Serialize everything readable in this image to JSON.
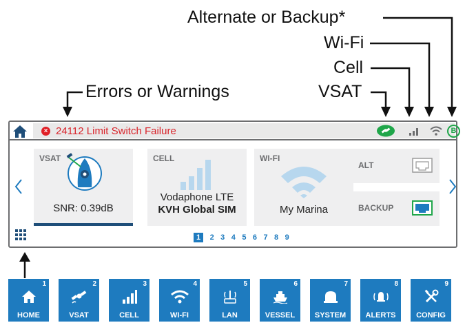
{
  "callouts": {
    "alternate": "Alternate or Backup*",
    "wifi": "Wi-Fi",
    "cell": "Cell",
    "vsat": "VSAT",
    "errors": "Errors or Warnings"
  },
  "statusbar": {
    "error_code_text": "24112 Limit Switch Failure",
    "error_icon_glyph": "×",
    "backup_badge": "B",
    "colors": {
      "error": "#d9232a",
      "vsat_online": "#1fa64a",
      "backup": "#1fa64a",
      "icon_gray": "#6d6e70"
    }
  },
  "tiles": {
    "vsat": {
      "label": "VSAT",
      "value": "SNR: 0.39dB"
    },
    "cell": {
      "label": "CELL",
      "line1": "Vodaphone LTE",
      "line2": "KVH Global SIM"
    },
    "wifi": {
      "label": "WI-FI",
      "value": "My Marina"
    },
    "alt": {
      "label": "ALT"
    },
    "backup": {
      "label": "BACKUP"
    }
  },
  "pager": {
    "pages": [
      "1",
      "2",
      "3",
      "4",
      "5",
      "6",
      "7",
      "8",
      "9"
    ],
    "active_page": "1"
  },
  "nav": [
    {
      "num": "1",
      "label": "HOME",
      "icon": "home-icon"
    },
    {
      "num": "2",
      "label": "VSAT",
      "icon": "satellite-icon"
    },
    {
      "num": "3",
      "label": "CELL",
      "icon": "cell-signal-icon"
    },
    {
      "num": "4",
      "label": "WI-FI",
      "icon": "wifi-icon"
    },
    {
      "num": "5",
      "label": "LAN",
      "icon": "router-icon"
    },
    {
      "num": "6",
      "label": "VESSEL",
      "icon": "ship-icon"
    },
    {
      "num": "7",
      "label": "SYSTEM",
      "icon": "system-icon"
    },
    {
      "num": "8",
      "label": "ALERTS",
      "icon": "bell-icon"
    },
    {
      "num": "9",
      "label": "CONFIG",
      "icon": "tools-icon"
    }
  ],
  "theme": {
    "accent": "#1e7bbf",
    "dark_accent": "#1f4e79",
    "tile_bg": "#efeff0"
  }
}
